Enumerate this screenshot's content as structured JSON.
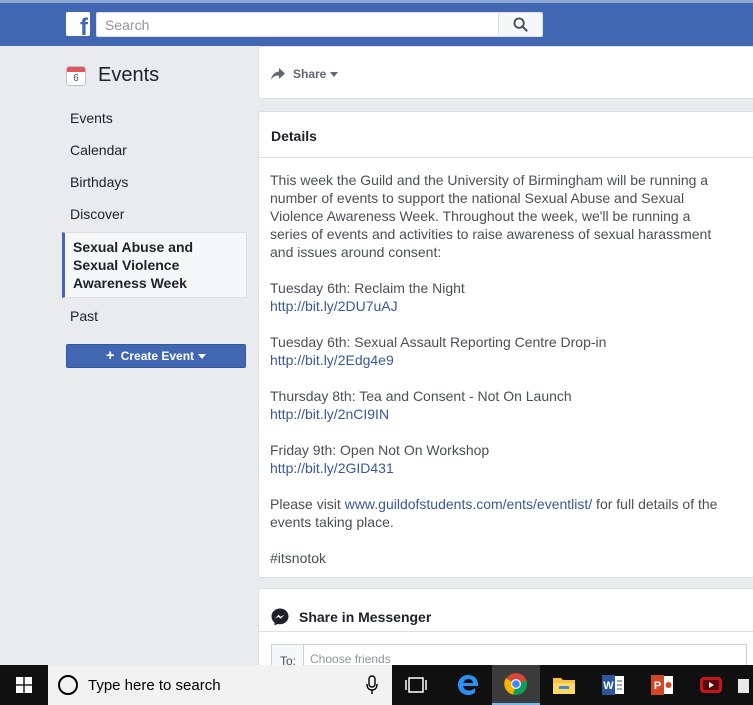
{
  "topbar": {
    "logo_letter": "f",
    "search_placeholder": "Search"
  },
  "sidebar": {
    "title": "Events",
    "calendar_day": "6",
    "items": [
      {
        "label": "Events"
      },
      {
        "label": "Calendar"
      },
      {
        "label": "Birthdays"
      },
      {
        "label": "Discover"
      },
      {
        "label": "Sexual Abuse and Sexual Violence Awareness Week"
      },
      {
        "label": "Past"
      }
    ],
    "create_button": "Create Event"
  },
  "share": {
    "label": "Share"
  },
  "details": {
    "heading": "Details",
    "intro": "This week the Guild and the University of Birmingham will be running a number of events to support the national Sexual Abuse and Sexual Violence Awareness Week. Throughout the week, we'll be running a series of events and activities to raise awareness of sexual harassment and issues around consent:",
    "events": [
      {
        "title": "Tuesday 6th: Reclaim the Night",
        "link": "http://bit.ly/2DU7uAJ"
      },
      {
        "title": "Tuesday 6th: Sexual Assault Reporting Centre Drop-in",
        "link": "http://bit.ly/2Edg4e9"
      },
      {
        "title": "Thursday 8th: Tea and Consent - Not On Launch",
        "link": "http://bit.ly/2nCI9IN"
      },
      {
        "title": "Friday 9th: Open Not On Workshop",
        "link": "http://bit.ly/2GID431"
      }
    ],
    "visit_prefix": "Please visit ",
    "visit_link": "www.guildofstudents.com/ents/eventlist/",
    "visit_suffix": " for full details of the events taking place.",
    "hashtag": "#itsnotok"
  },
  "messenger": {
    "heading": "Share in Messenger",
    "to_label": "To:",
    "to_placeholder": "Choose friends"
  },
  "taskbar": {
    "search_placeholder": "Type here to search"
  },
  "colors": {
    "brand": "#4267b2",
    "link": "#385898",
    "background": "#e9ebee"
  }
}
